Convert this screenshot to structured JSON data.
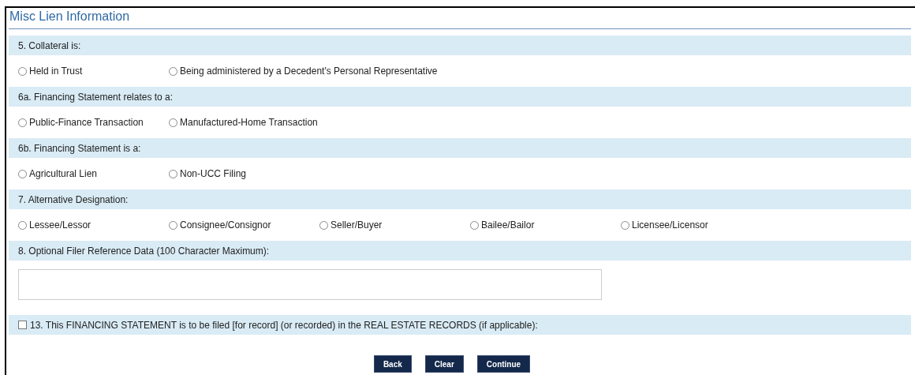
{
  "panel": {
    "title": "Misc Lien Information"
  },
  "sections": [
    {
      "kind": "radios",
      "label": "5. Collateral is:",
      "options": [
        {
          "label": "Held in Trust",
          "selected": false
        },
        {
          "label": "Being administered by a Decedent's Personal Representative",
          "selected": false
        }
      ]
    },
    {
      "kind": "radios",
      "label": "6a. Financing Statement relates to a:",
      "options": [
        {
          "label": "Public-Finance Transaction",
          "selected": false
        },
        {
          "label": "Manufactured-Home Transaction",
          "selected": false
        }
      ]
    },
    {
      "kind": "radios",
      "label": "6b. Financing Statement is a:",
      "options": [
        {
          "label": "Agricultural Lien",
          "selected": false
        },
        {
          "label": "Non-UCC Filing",
          "selected": false
        }
      ]
    },
    {
      "kind": "radios",
      "label": "7. Alternative Designation:",
      "options": [
        {
          "label": "Lessee/Lessor",
          "selected": false
        },
        {
          "label": "Consignee/Consignor",
          "selected": false
        },
        {
          "label": "Seller/Buyer",
          "selected": false
        },
        {
          "label": "Bailee/Bailor",
          "selected": false
        },
        {
          "label": "Licensee/Licensor",
          "selected": false
        }
      ]
    },
    {
      "kind": "textarea",
      "label": "8. Optional Filer Reference Data (100 Character Maximum):"
    },
    {
      "kind": "checkbox",
      "label": "13. This FINANCING STATEMENT is to be filed [for record] (or recorded) in the REAL ESTATE RECORDS (if applicable):",
      "checked": false
    }
  ],
  "buttons": [
    "Back",
    "Clear",
    "Continue"
  ]
}
